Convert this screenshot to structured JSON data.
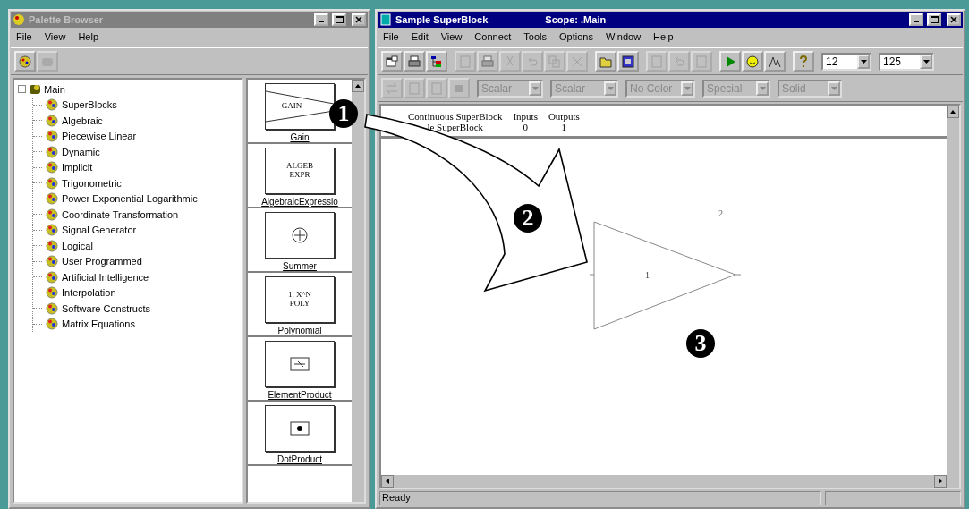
{
  "palette_window": {
    "title": "Palette Browser",
    "active": false,
    "menu": [
      "File",
      "View",
      "Help"
    ],
    "toolbar": [
      {
        "kind": "palette",
        "disabled": false
      },
      {
        "kind": "blocks",
        "disabled": true
      }
    ],
    "tree": {
      "label": "Main",
      "expanded": true,
      "children": [
        {
          "label": "SuperBlocks"
        },
        {
          "label": "Algebraic"
        },
        {
          "label": "Piecewise Linear"
        },
        {
          "label": "Dynamic"
        },
        {
          "label": "Implicit"
        },
        {
          "label": "Trigonometric"
        },
        {
          "label": "Power Exponential Logarithmic"
        },
        {
          "label": "Coordinate Transformation"
        },
        {
          "label": "Signal Generator"
        },
        {
          "label": "Logical"
        },
        {
          "label": "User Programmed"
        },
        {
          "label": "Artificial Intelligence"
        },
        {
          "label": "Interpolation"
        },
        {
          "label": "Software Constructs"
        },
        {
          "label": "Matrix Equations"
        }
      ]
    },
    "blocks": [
      {
        "label": "Gain",
        "kind": "gain",
        "icon_text": [
          "GAIN"
        ]
      },
      {
        "label": "AlgebraicExpressio",
        "kind": "text",
        "icon_text": [
          "ALGEB",
          "EXPR"
        ]
      },
      {
        "label": "Summer",
        "kind": "summer"
      },
      {
        "label": "Polynomial",
        "kind": "text",
        "icon_text": [
          "1, X^N",
          "POLY"
        ]
      },
      {
        "label": "ElementProduct",
        "kind": "elemprod"
      },
      {
        "label": "DotProduct",
        "kind": "dotprod"
      }
    ]
  },
  "editor_window": {
    "title": "Sample SuperBlock",
    "scope": "Scope: .Main",
    "active": true,
    "menu": [
      "File",
      "Edit",
      "View",
      "Connect",
      "Tools",
      "Options",
      "Window",
      "Help"
    ],
    "toolbar": [
      [
        {
          "kind": "window",
          "disabled": false
        },
        {
          "kind": "print",
          "disabled": false
        },
        {
          "kind": "tree",
          "disabled": false
        }
      ],
      [
        {
          "kind": "doc",
          "disabled": true
        },
        {
          "kind": "print",
          "disabled": true
        },
        {
          "kind": "cut",
          "disabled": true
        },
        {
          "kind": "undo",
          "disabled": true
        },
        {
          "kind": "copy",
          "disabled": true
        },
        {
          "kind": "delete",
          "disabled": true
        }
      ],
      [
        {
          "kind": "folder",
          "disabled": false
        },
        {
          "kind": "image",
          "disabled": false
        }
      ],
      [
        {
          "kind": "doc",
          "disabled": true
        },
        {
          "kind": "undo",
          "disabled": true
        },
        {
          "kind": "doc",
          "disabled": true
        }
      ],
      [
        {
          "kind": "play",
          "disabled": false
        },
        {
          "kind": "face",
          "disabled": false
        },
        {
          "kind": "graph",
          "disabled": false
        }
      ],
      [
        {
          "kind": "help",
          "disabled": false
        }
      ]
    ],
    "combos": [
      {
        "value": "12",
        "disabled": false
      },
      {
        "value": "125",
        "disabled": false
      }
    ],
    "toolbar2": [
      {
        "kind": "swap",
        "disabled": true
      },
      {
        "kind": "doc",
        "disabled": true
      },
      {
        "kind": "doc",
        "disabled": true
      },
      {
        "kind": "square",
        "disabled": true
      }
    ],
    "combos2": [
      {
        "value": "Scalar",
        "disabled": true
      },
      {
        "value": "Scalar",
        "disabled": true
      },
      {
        "value": "No Color",
        "disabled": true
      },
      {
        "value": "Special",
        "disabled": true
      },
      {
        "value": "Solid",
        "disabled": true
      }
    ],
    "header": {
      "columns": [
        "Continuous SuperBlock",
        "Inputs",
        "Outputs"
      ],
      "row": [
        "le SuperBlock",
        "0",
        "1"
      ]
    },
    "diagram": {
      "block_id": "1",
      "output_label": "2"
    },
    "status": "Ready"
  },
  "callouts": [
    "1",
    "2",
    "3"
  ]
}
